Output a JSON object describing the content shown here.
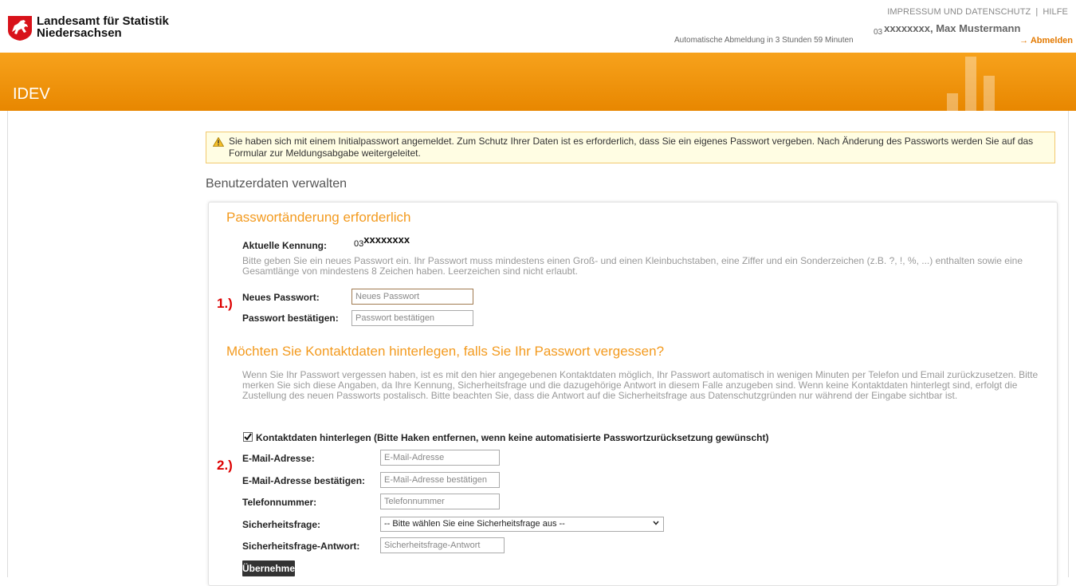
{
  "header": {
    "brand_line1": "Landesamt für Statistik",
    "brand_line2": "Niedersachsen",
    "links": [
      "IMPRESSUM UND DATENSCHUTZ",
      "HILFE"
    ],
    "user_prefix": "03",
    "user_name": "xxxxxxxx, Max Mustermann",
    "logout_info": "Automatische Abmeldung in 3 Stunden 59 Minuten",
    "logout_label": "→ Abmelden"
  },
  "band": {
    "title": "IDEV"
  },
  "warning": {
    "text": "Sie haben sich mit einem Initialpasswort angemeldet. Zum Schutz Ihrer Daten ist es erforderlich, dass Sie ein eigenes Passwort vergeben. Nach Änderung des Passworts werden Sie auf das Formular zur Meldungsabgabe weitergeleitet."
  },
  "page": {
    "section_title": "Benutzerdaten verwalten"
  },
  "password": {
    "heading": "Passwortänderung erforderlich",
    "kennung_label": "Aktuelle Kennung:",
    "kennung_prefix": "03",
    "kennung_value": "xxxxxxxx",
    "instructions": "Bitte geben Sie ein neues Passwort ein. Ihr Passwort muss mindestens einen Groß- und einen Kleinbuchstaben, eine Ziffer und ein Sonderzeichen (z.B. ?, !, %, ...) enthalten sowie eine Gesamtlänge von mindestens 8 Zeichen haben. Leerzeichen sind nicht erlaubt.",
    "marker": "1.)",
    "new_label": "Neues Passwort:",
    "new_placeholder": "Neues Passwort",
    "confirm_label": "Passwort bestätigen:",
    "confirm_placeholder": "Passwort bestätigen"
  },
  "contact": {
    "heading": "Möchten Sie Kontaktdaten hinterlegen, falls Sie Ihr Passwort vergessen?",
    "description": "Wenn Sie Ihr Passwort vergessen haben, ist es mit den hier angegebenen Kontaktdaten möglich, Ihr Passwort automatisch in wenigen Minuten per Telefon und Email zurückzusetzen. Bitte merken Sie sich diese Angaben, da Ihre Kennung, Sicherheitsfrage und die dazugehörige Antwort in diesem Falle anzugeben sind. Wenn keine Kontaktdaten hinterlegt sind, erfolgt die Zustellung des neuen Passworts postalisch. Bitte beachten Sie, dass die Antwort auf die Sicherheitsfrage aus Datenschutzgründen nur während der Eingabe sichtbar ist.",
    "checkbox_label": "Kontaktdaten hinterlegen (Bitte Haken entfernen, wenn keine automatisierte Passwortzurücksetzung gewünscht)",
    "checked": true,
    "marker": "2.)",
    "email_label": "E-Mail-Adresse:",
    "email_placeholder": "E-Mail-Adresse",
    "email_confirm_label": "E-Mail-Adresse bestätigen:",
    "email_confirm_placeholder": "E-Mail-Adresse bestätigen",
    "phone_label": "Telefonnummer:",
    "phone_placeholder": "Telefonnummer",
    "question_label": "Sicherheitsfrage:",
    "question_selected": "-- Bitte wählen Sie eine Sicherheitsfrage aus --",
    "answer_label": "Sicherheitsfrage-Antwort:",
    "answer_placeholder": "Sicherheitsfrage-Antwort",
    "submit_label": "Übernehmen"
  },
  "colors": {
    "accent": "#f39a1e",
    "band": "#f7a21c",
    "marker": "#dd0000"
  }
}
